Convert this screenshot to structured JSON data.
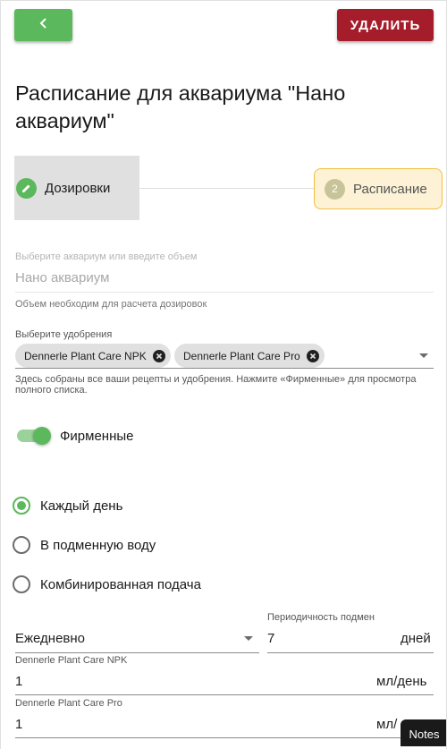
{
  "header": {
    "back_icon": "chevron-left-icon",
    "delete_label": "Удалить"
  },
  "page_title": "Расписание для аквариума \"Нано аквариум\"",
  "stepper": {
    "steps": [
      {
        "label": "Дозировки",
        "icon": "pencil-icon",
        "state": "completed"
      },
      {
        "label": "Расписание",
        "number": "2",
        "state": "active"
      }
    ]
  },
  "aquarium": {
    "label": "Выберите аквариум или введите объем",
    "value": "Нано аквариум",
    "helper": "Объем необходим для расчета дозировок"
  },
  "fertilizers": {
    "label": "Выберите удобрения",
    "chips": [
      "Dennerle Plant Care NPK",
      "Dennerle Plant Care Pro"
    ],
    "helper": "Здесь собраны все ваши рецепты и удобрения. Нажмите «Фирменные» для просмотра полного списка."
  },
  "branded_toggle": {
    "label": "Фирменные",
    "checked": true
  },
  "dosing_mode": {
    "options": [
      {
        "label": "Каждый день",
        "checked": true
      },
      {
        "label": "В подменную воду",
        "checked": false
      },
      {
        "label": "Комбинированная подача",
        "checked": false
      }
    ]
  },
  "frequency": {
    "value": "Ежедневно"
  },
  "water_change": {
    "label": "Периодичность подмен",
    "value": "7",
    "unit": "дней"
  },
  "doses": [
    {
      "label": "Dennerle Plant Care NPK",
      "value": "1",
      "unit": "мл/день"
    },
    {
      "label": "Dennerle Plant Care Pro",
      "value": "1",
      "unit": "мл/"
    }
  ],
  "notes_tab": "Notes",
  "colors": {
    "primary": "#5cb85c",
    "danger": "#a51d2a",
    "active_step_bg": "#fdf2d5",
    "active_step_border": "#f0c040"
  }
}
